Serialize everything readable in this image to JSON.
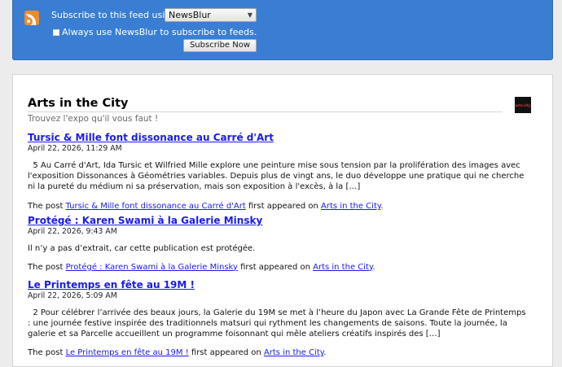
{
  "subscribe": {
    "label": "Subscribe to this feed using",
    "reader_selected": "NewsBlur",
    "always_label": "Always use NewsBlur to subscribe to feeds.",
    "button_label": "Subscribe Now"
  },
  "feed": {
    "title": "Arts in the City",
    "subtitle": "Trouvez l'expo qu'il vous faut !",
    "logo_text": "arts·city"
  },
  "items": [
    {
      "title": "Tursic & Mille font dissonance au Carré d'Art",
      "date": "April 22, 2026, 11:29 AM",
      "body": "  5 Au Carré d'Art, Ida Tursic et Wilfried Mille explore une peinture mise sous tension par la prolifération des images avec l'exposition Dissonances à Géométries variables. Depuis plus de vingt ans, le duo développe une pratique qui ne cherche ni la pureté du médium ni sa préservation, mais son exposition à l'excès, à la […]",
      "foot_prefix": "The post",
      "foot_link": "Tursic & Mille font dissonance au Carré d'Art",
      "foot_mid": "first appeared on",
      "foot_site": "Arts in the City",
      "foot_end": "."
    },
    {
      "title": "Protégé : Karen Swami à la Galerie Minsky",
      "date": "April 22, 2026, 9:43 AM",
      "body": "Il n’y a pas d’extrait, car cette publication est protégée.",
      "foot_prefix": "The post",
      "foot_link": "Protégé : Karen Swami à la Galerie Minsky",
      "foot_mid": "first appeared on",
      "foot_site": "Arts in the City",
      "foot_end": "."
    },
    {
      "title": "Le Printemps en fête au 19M !",
      "date": "April 22, 2026, 5:09 AM",
      "body": "  2 Pour célébrer l’arrivée des beaux jours, la Galerie du 19M se met à l’heure du Japon avec La Grande Fête de Printemps : une journée festive inspirée des traditionnels matsuri qui rythment les changements de saisons. Toute la journée, la galerie et sa Parcelle accueillent un programme foisonnant qui mêle ateliers créatifs inspirés des […]",
      "foot_prefix": "The post",
      "foot_link": "Le Printemps en fête au 19M !",
      "foot_mid": "first appeared on",
      "foot_site": "Arts in the City",
      "foot_end": "."
    }
  ],
  "colors": {
    "header_bg": "#3a7ed3",
    "link": "#1a1aee",
    "rss": "#f18a2d"
  }
}
